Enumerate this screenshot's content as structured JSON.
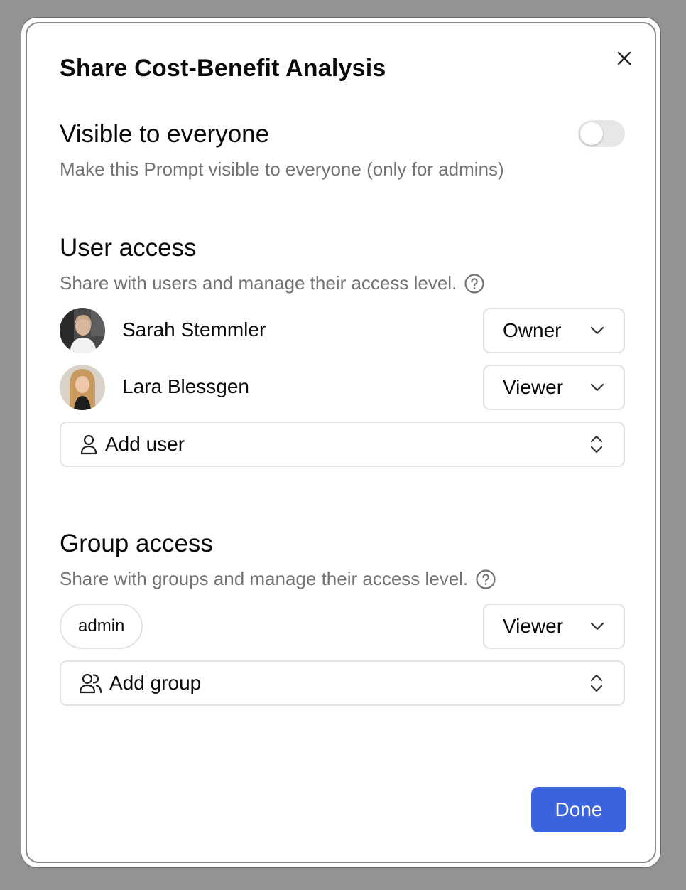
{
  "dialog": {
    "title": "Share Cost-Benefit Analysis"
  },
  "visibility": {
    "title": "Visible to everyone",
    "description": "Make this Prompt visible to everyone (only for admins)",
    "enabled": false
  },
  "user_access": {
    "title": "User access",
    "description": "Share with users and manage their access level.",
    "users": [
      {
        "name": "Sarah Stemmler",
        "role": "Owner"
      },
      {
        "name": "Lara Blessgen",
        "role": "Viewer"
      }
    ],
    "add_label": "Add user"
  },
  "group_access": {
    "title": "Group access",
    "description": "Share with groups and manage their access level.",
    "groups": [
      {
        "name": "admin",
        "role": "Viewer"
      }
    ],
    "add_label": "Add group"
  },
  "footer": {
    "done_label": "Done"
  },
  "colors": {
    "accent": "#3b63de",
    "backdrop": "#939393",
    "muted_text": "#737373",
    "border": "#e3e3e3"
  }
}
